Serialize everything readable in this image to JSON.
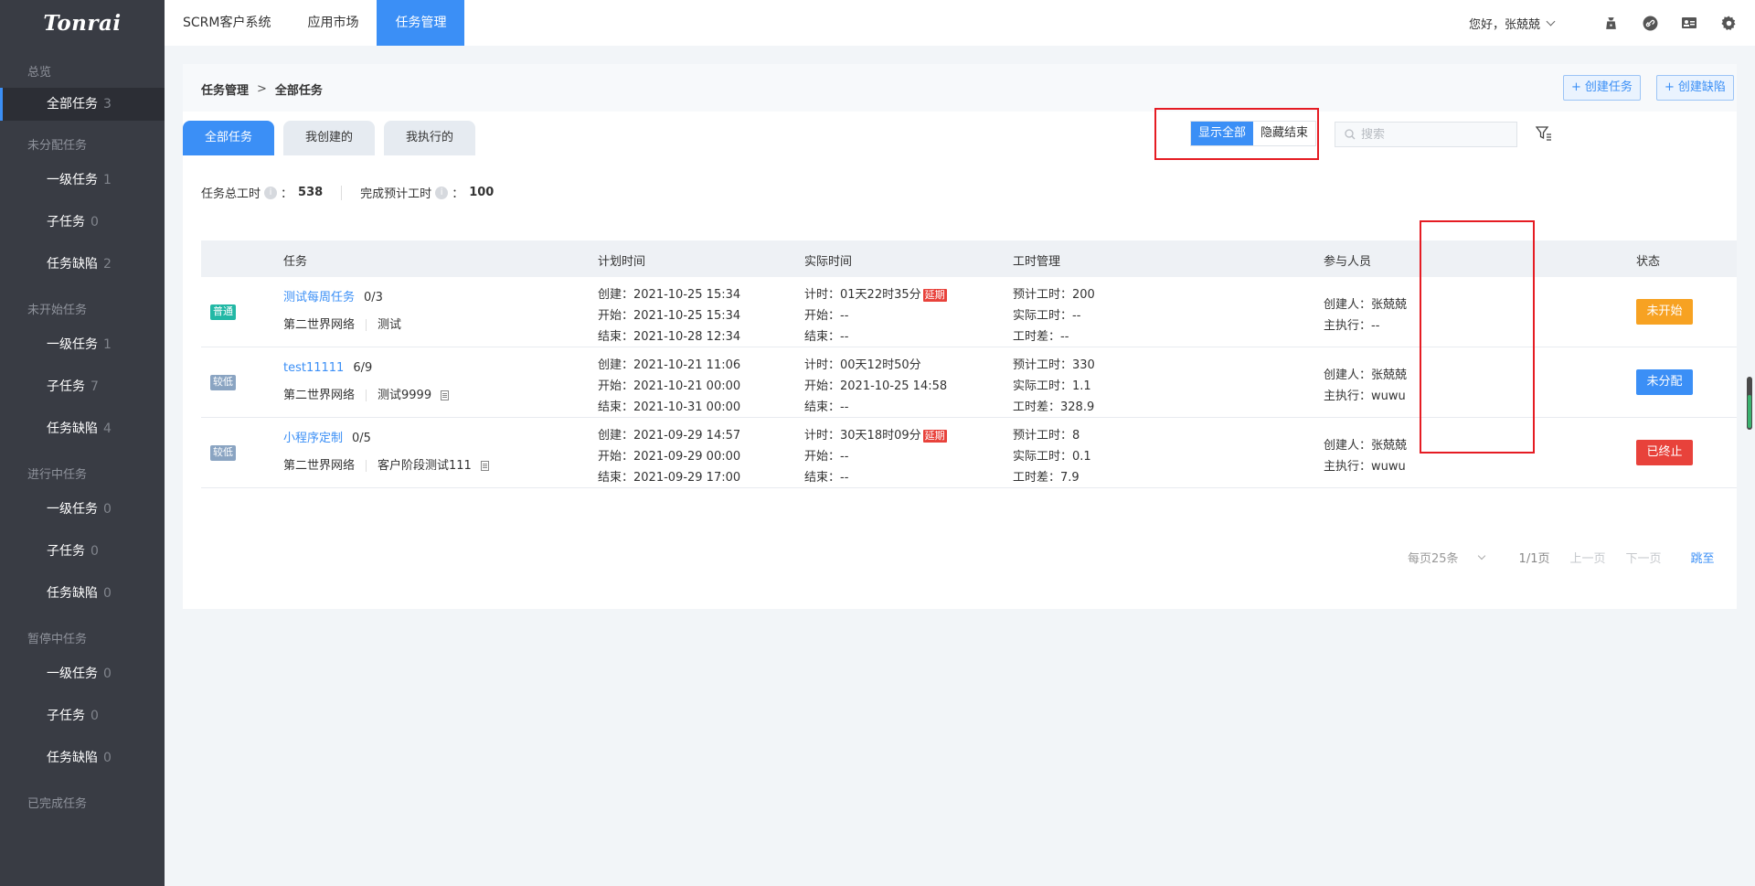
{
  "app": {
    "logo": "Tonrai"
  },
  "topnav": [
    {
      "label": "SCRM客户系统"
    },
    {
      "label": "应用市场"
    },
    {
      "label": "任务管理",
      "active": true
    }
  ],
  "user": {
    "greeting": "您好，张兢兢"
  },
  "sidebar": {
    "groups": [
      {
        "title": "总览",
        "items": [
          {
            "label": "全部任务",
            "count": "3",
            "active": true
          }
        ]
      },
      {
        "title": "未分配任务",
        "items": [
          {
            "label": "一级任务",
            "count": "1"
          },
          {
            "label": "子任务",
            "count": "0"
          },
          {
            "label": "任务缺陷",
            "count": "2"
          }
        ]
      },
      {
        "title": "未开始任务",
        "items": [
          {
            "label": "一级任务",
            "count": "1"
          },
          {
            "label": "子任务",
            "count": "7"
          },
          {
            "label": "任务缺陷",
            "count": "4"
          }
        ]
      },
      {
        "title": "进行中任务",
        "items": [
          {
            "label": "一级任务",
            "count": "0"
          },
          {
            "label": "子任务",
            "count": "0"
          },
          {
            "label": "任务缺陷",
            "count": "0"
          }
        ]
      },
      {
        "title": "暂停中任务",
        "items": [
          {
            "label": "一级任务",
            "count": "0"
          },
          {
            "label": "子任务",
            "count": "0"
          },
          {
            "label": "任务缺陷",
            "count": "0"
          }
        ]
      },
      {
        "title": "已完成任务",
        "items": []
      }
    ]
  },
  "breadcrumb": {
    "parent": "任务管理",
    "sep": ">",
    "current": "全部任务"
  },
  "buttons": {
    "create_task": "创建任务",
    "create_defect": "创建缺陷"
  },
  "tabs": [
    {
      "label": "全部任务",
      "active": true
    },
    {
      "label": "我创建的"
    },
    {
      "label": "我执行的"
    }
  ],
  "stats": {
    "total_label": "任务总工时",
    "total_value": "538",
    "done_label": "完成预计工时",
    "done_value": "100",
    "colon": "："
  },
  "toggle": {
    "show_all": "显示全部",
    "hide_done": "隐藏结束"
  },
  "search": {
    "placeholder": "搜索"
  },
  "table": {
    "headers": {
      "task": "任务",
      "plan": "计划时间",
      "actual": "实际时间",
      "hours": "工时管理",
      "people": "参与人员",
      "status": "状态"
    },
    "rows": [
      {
        "priority": "普通",
        "priority_type": "normal",
        "name": "测试每周任务",
        "progress": "0/3",
        "project": "第二世界网络",
        "client": "测试",
        "has_doc": false,
        "plan": [
          "创建：2021-10-25 15:34",
          "开始：2021-10-25 15:34",
          "结束：2021-10-28 12:34"
        ],
        "actual_timer": "计时：01天22时35分",
        "delayed": "延期",
        "actual": [
          "开始：--",
          "结束：--"
        ],
        "hours": [
          "预计工时：200",
          "实际工时：--",
          "工时差：--"
        ],
        "people": [
          "创建人：张兢兢",
          "主执行：--"
        ],
        "status": "未开始",
        "status_color": "orange"
      },
      {
        "priority": "较低",
        "priority_type": "low",
        "name": "test11111",
        "progress": "6/9",
        "project": "第二世界网络",
        "client": "测试9999",
        "has_doc": true,
        "plan": [
          "创建：2021-10-21 11:06",
          "开始：2021-10-21 00:00",
          "结束：2021-10-31 00:00"
        ],
        "actual_timer": "计时：00天12时50分",
        "delayed": "",
        "actual": [
          "开始：2021-10-25 14:58",
          "结束：--"
        ],
        "hours": [
          "预计工时：330",
          "实际工时：1.1",
          "工时差：328.9"
        ],
        "people": [
          "创建人：张兢兢",
          "主执行：wuwu"
        ],
        "status": "未分配",
        "status_color": "blue"
      },
      {
        "priority": "较低",
        "priority_type": "low",
        "name": "小程序定制",
        "progress": "0/5",
        "project": "第二世界网络",
        "client": "客户阶段测试111",
        "has_doc": true,
        "plan": [
          "创建：2021-09-29 14:57",
          "开始：2021-09-29 00:00",
          "结束：2021-09-29 17:00"
        ],
        "actual_timer": "计时：30天18时09分",
        "delayed": "延期",
        "actual": [
          "开始：--",
          "结束：--"
        ],
        "hours": [
          "预计工时：8",
          "实际工时：0.1",
          "工时差：7.9"
        ],
        "people": [
          "创建人：张兢兢",
          "主执行：wuwu"
        ],
        "status": "已终止",
        "status_color": "red"
      }
    ]
  },
  "pager": {
    "page_size": "每页25条",
    "page_info": "1/1页",
    "prev": "上一页",
    "next": "下一页",
    "jump": "跳至"
  }
}
